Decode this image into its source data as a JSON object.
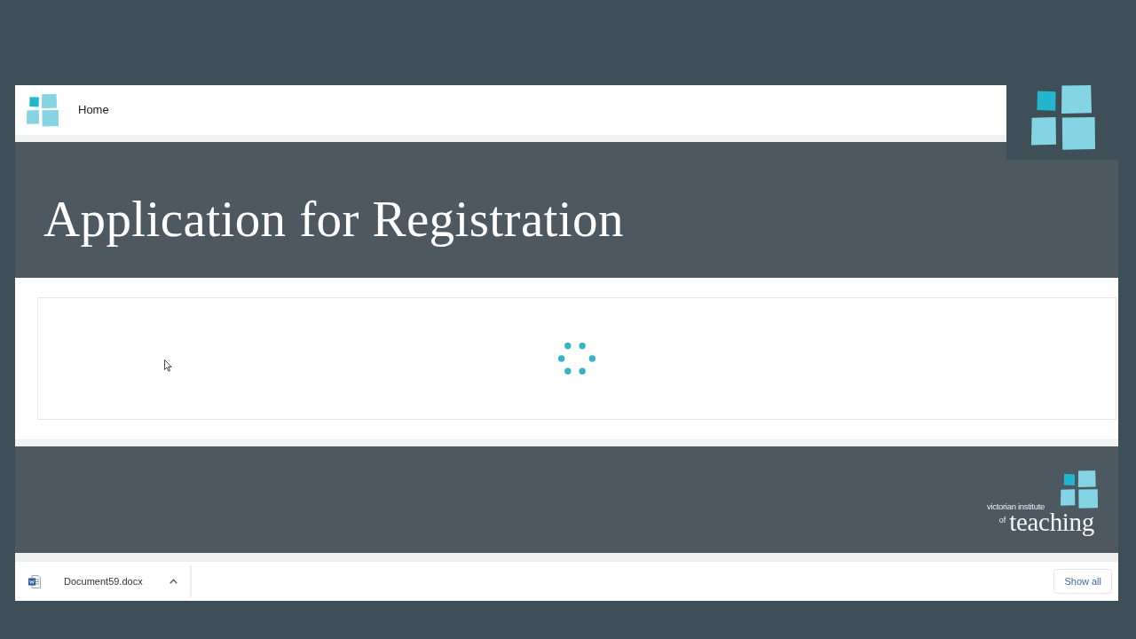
{
  "header": {
    "nav_link": "Home"
  },
  "banner": {
    "title": "Application for Registration"
  },
  "content": {
    "loading": true
  },
  "footer": {
    "logo": {
      "tagline": "victorian institute",
      "prefix": "of",
      "wordmark": "teaching"
    }
  },
  "download_bar": {
    "items": [
      {
        "file_name": "Document59.docx"
      }
    ],
    "show_all_label": "Show all"
  }
}
